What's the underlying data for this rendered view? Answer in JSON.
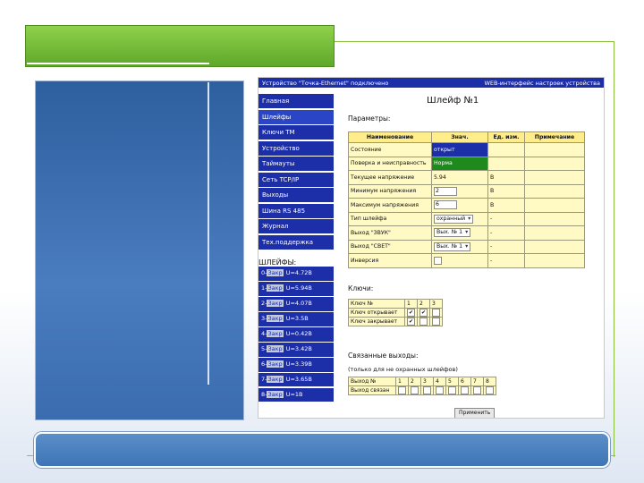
{
  "header": {
    "status": "Устройство \"Точка-Ethernet\" подключено",
    "title": "WEB-интерфейс настроек устройства"
  },
  "nav": {
    "items": [
      "Главная",
      "Шлейфы",
      "Ключи ТМ",
      "Устройство",
      "Таймауты",
      "Сеть TCP/IP",
      "Выходы",
      "Шина RS 485",
      "Журнал",
      "Тех.поддержка"
    ],
    "active_index": 1
  },
  "sensors": {
    "title": "ШЛЕЙФЫ:",
    "items": [
      {
        "prefix": "0-",
        "state": "Закр",
        "value": "U=4.72В"
      },
      {
        "prefix": "1-",
        "state": "Закр",
        "value": "U=5.94В"
      },
      {
        "prefix": "2-",
        "state": "Закр",
        "value": "U=4.07В"
      },
      {
        "prefix": "3-",
        "state": "Закр",
        "value": "U=3.5В"
      },
      {
        "prefix": "4-",
        "state": "Закр",
        "value": "U=0.42В"
      },
      {
        "prefix": "5-",
        "state": "Закр",
        "value": "U=3.42В"
      },
      {
        "prefix": "6-",
        "state": "Закр",
        "value": "U=3.39В"
      },
      {
        "prefix": "7-",
        "state": "Закр",
        "value": "U=3.65В"
      },
      {
        "prefix": "8-",
        "state": "Закр",
        "value": "U=1В"
      }
    ]
  },
  "main": {
    "title": "Шлейф №1",
    "params_label": "Параметры:",
    "params_headers": [
      "Наименование",
      "Знач.",
      "Ед. изм.",
      "Примечание"
    ],
    "params_rows": [
      {
        "name": "Состояние",
        "value": "открыт",
        "unit": "",
        "note": ""
      },
      {
        "name": "Поверка и неисправность",
        "value": "Норма",
        "unit": "",
        "note": ""
      },
      {
        "name": "Текущее напряжение",
        "value": "5.94",
        "unit": "В",
        "note": ""
      },
      {
        "name": "Минимум напряжения",
        "value": "2",
        "unit": "В",
        "note": ""
      },
      {
        "name": "Максимум напряжения",
        "value": "6",
        "unit": "В",
        "note": ""
      },
      {
        "name": "Тип шлейфа",
        "value": "охранный",
        "unit": "-",
        "note": ""
      },
      {
        "name": "Выход \"ЗВУК\"",
        "value": "Вых. № 1",
        "unit": "-",
        "note": ""
      },
      {
        "name": "Выход \"СВЕТ\"",
        "value": "Вых. № 1",
        "unit": "-",
        "note": ""
      },
      {
        "name": "Инверсия",
        "value": "",
        "unit": "-",
        "note": ""
      }
    ],
    "keys_label": "Ключи:",
    "keys": {
      "header": "Ключ №",
      "numbers": [
        "1",
        "2",
        "3"
      ],
      "row_open": "Ключ открывает",
      "row_close": "Ключ закрывает"
    },
    "outputs_label": "Связанные выходы:",
    "outputs_note": "(только для не охранных шлейфов)",
    "outputs": {
      "header": "Выход №",
      "numbers": [
        "1",
        "2",
        "3",
        "4",
        "5",
        "6",
        "7",
        "8"
      ],
      "row": "Выход связан"
    },
    "apply_label": "Применить"
  },
  "colors": {
    "accent_green": "#8cbf3f",
    "web_nav_blue": "#1c2ea8",
    "table_yellow": "#fff9c4",
    "state_open_blue": "#1c2ea8",
    "state_normal_green": "#1e8a1e"
  }
}
